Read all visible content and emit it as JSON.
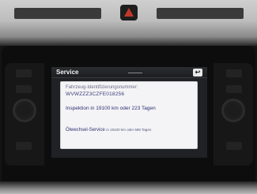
{
  "screen": {
    "title": "Service",
    "back_icon": "back-arrow-icon",
    "back_glyph": "↩"
  },
  "service_info": {
    "vin_label": "Fahrzeug-Identifizierungsnummer:",
    "vin_value": "WVWZZZ3CZFE018256",
    "inspection": "Inspektion in 19100 km oder 223 Tagen",
    "oil_service_label": "Ölwechsel-Service",
    "oil_service_detail": "in 19100 km oder 588 Tagen"
  },
  "colors": {
    "card_text": "#2d3072",
    "hazard_red": "#c0392b",
    "screen_bg": "#1f2124"
  }
}
